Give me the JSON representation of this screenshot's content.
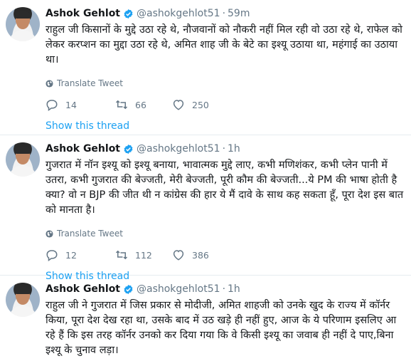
{
  "colors": {
    "link": "#1da1f2",
    "secondary_text": "#657786",
    "primary_text": "#14171a",
    "divider": "#e6ecf0",
    "verified_badge": "#1da1f2"
  },
  "icons": {
    "verified": "verified-badge-icon",
    "translate": "globe-icon",
    "reply": "reply-icon",
    "retweet": "retweet-icon",
    "like": "heart-icon"
  },
  "tweets": [
    {
      "name": "Ashok Gehlot",
      "handle": "@ashokgehlot51",
      "separator": "·",
      "time": "59m",
      "text": "राहुल जी किसानों के मुद्दे उठा रहे थे, नौजवानों को नौकरी नहीं मिल रही वो उठा रहे थे, राफेल को लेकर करप्शन का मुद्दा उठा रहे थे, अमित शाह जी के बेटे का इश्यू उठाया था, महंगाई का उठाया था।",
      "translate_label": "Translate Tweet",
      "replies": "14",
      "retweets": "66",
      "likes": "250",
      "thread_label": "Show this thread"
    },
    {
      "name": "Ashok Gehlot",
      "handle": "@ashokgehlot51",
      "separator": "·",
      "time": "1h",
      "text": "गुजरात में नॉन इश्यू को इश्यू बनाया, भावात्मक मुद्दे लाए, कभी मणिशंकर, कभी प्लेन पानी में उतरा, कभी गुजरात की बेज्जती, मेरी बेज्जती, पूरी कौम की बेज्जती...ये PM की भाषा होती है क्या? वो न BJP की जीत थी न कांग्रेस की हार ये मैं दावे के साथ कह सकता हूँ, पूरा देश इस बात को मानता है।",
      "translate_label": "Translate Tweet",
      "replies": "12",
      "retweets": "112",
      "likes": "386",
      "thread_label": "Show this thread"
    },
    {
      "name": "Ashok Gehlot",
      "handle": "@ashokgehlot51",
      "separator": "·",
      "time": "1h",
      "text": "राहुल जी ने गुजरात में जिस प्रकार से मोदीजी, अमित शाहजी को उनके खुद के राज्य में कॉर्नर किया, पूरा देश देख रहा था, उसके बाद में उठ खड़े ही नहीं हुए, आज के ये परिणाम इसलिए आ रहे हैं कि इस तरह कॉर्नर उनको कर दिया गया कि वे किसी इश्यू का जवाब ही नहीं दे पाए,बिना इश्यू के चुनाव लड़ा।"
    }
  ]
}
